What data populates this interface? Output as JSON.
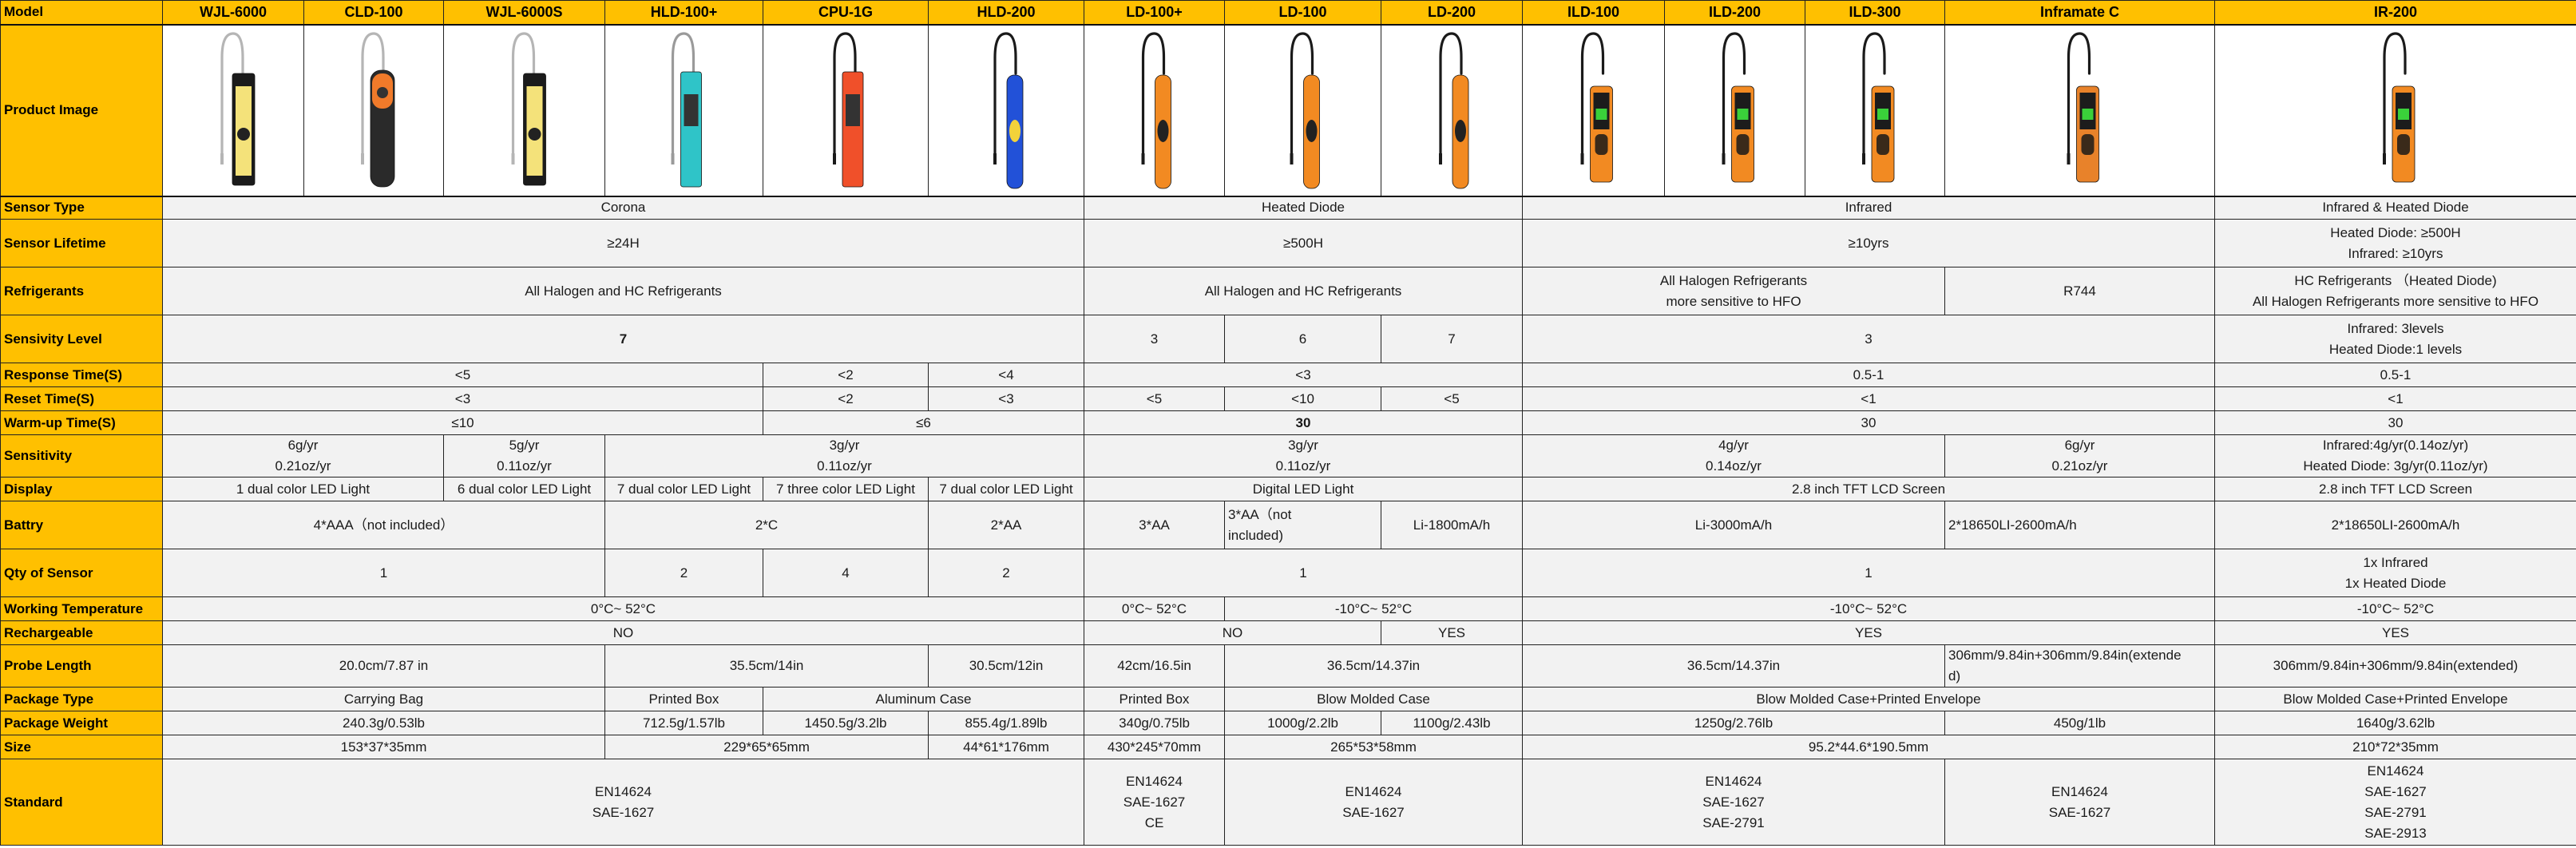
{
  "corner_label": "Model",
  "models": [
    "WJL-6000",
    "CLD-100",
    "WJL-6000S",
    "HLD-100+",
    "CPU-1G",
    "HLD-200",
    "LD-100+",
    "LD-100",
    "LD-200",
    "ILD-100",
    "ILD-200",
    "ILD-300",
    "Inframate C",
    "IR-200"
  ],
  "product_image_label": "Product Image",
  "product_images": [
    {
      "model": "WJL-6000",
      "body": "#1b1b1b",
      "panel": "#f4e27a",
      "probe": "#b5b5b5",
      "style": "bar"
    },
    {
      "model": "CLD-100",
      "body": "#2a2a2a",
      "panel": "#f07a2a",
      "probe": "#b5b5b5",
      "style": "round"
    },
    {
      "model": "WJL-6000S",
      "body": "#1b1b1b",
      "panel": "#f4e27a",
      "probe": "#b5b5b5",
      "style": "bar"
    },
    {
      "model": "HLD-100+",
      "body": "#2fc4c8",
      "panel": "#333333",
      "probe": "#9a9a9a",
      "style": "slab"
    },
    {
      "model": "CPU-1G",
      "body": "#f0502a",
      "panel": "#333333",
      "probe": "#1a1a1a",
      "style": "slab"
    },
    {
      "model": "HLD-200",
      "body": "#2251d8",
      "panel": "#f2d23a",
      "probe": "#1a1a1a",
      "style": "wand"
    },
    {
      "model": "LD-100+",
      "body": "#f28a22",
      "panel": "#222222",
      "probe": "#1a1a1a",
      "style": "wand"
    },
    {
      "model": "LD-100",
      "body": "#f28a22",
      "panel": "#222222",
      "probe": "#1a1a1a",
      "style": "wand"
    },
    {
      "model": "LD-200",
      "body": "#f28a22",
      "panel": "#222222",
      "probe": "#1a1a1a",
      "style": "wand"
    },
    {
      "model": "ILD-100",
      "body": "#f28a22",
      "panel": "#1c1c1c",
      "probe": "#1a1a1a",
      "style": "screen"
    },
    {
      "model": "ILD-200",
      "body": "#f28a22",
      "panel": "#1c1c1c",
      "probe": "#1a1a1a",
      "style": "screen"
    },
    {
      "model": "ILD-300",
      "body": "#f28a22",
      "panel": "#1c1c1c",
      "probe": "#1a1a1a",
      "style": "screen"
    },
    {
      "model": "Inframate C",
      "body": "#e8822a",
      "panel": "#1c1c1c",
      "probe": "#1a1a1a",
      "style": "screen"
    },
    {
      "model": "IR-200",
      "body": "#f28a22",
      "panel": "#1c1c1c",
      "probe": "#1a1a1a",
      "style": "screen"
    }
  ],
  "rows": [
    {
      "label": "Sensor Type",
      "cells": [
        {
          "span": 6,
          "lines": [
            "Corona"
          ]
        },
        {
          "span": 3,
          "lines": [
            "Heated Diode"
          ]
        },
        {
          "span": 4,
          "lines": [
            "Infrared"
          ]
        },
        {
          "span": 1,
          "lines": [
            "Infrared & Heated Diode"
          ]
        }
      ]
    },
    {
      "label": "Sensor Lifetime",
      "cells": [
        {
          "span": 6,
          "lines": [
            "≥24H"
          ]
        },
        {
          "span": 3,
          "lines": [
            "≥500H"
          ]
        },
        {
          "span": 4,
          "lines": [
            "≥10yrs"
          ]
        },
        {
          "span": 1,
          "lines": [
            "Heated Diode: ≥500H",
            "Infrared: ≥10yrs"
          ]
        }
      ]
    },
    {
      "label": "Refrigerants",
      "cells": [
        {
          "span": 6,
          "lines": [
            "All Halogen and HC Refrigerants"
          ]
        },
        {
          "span": 3,
          "lines": [
            "All Halogen and HC Refrigerants"
          ]
        },
        {
          "span": 3,
          "lines": [
            "All Halogen Refrigerants",
            "more sensitive to HFO"
          ]
        },
        {
          "span": 1,
          "lines": [
            "R744"
          ]
        },
        {
          "span": 1,
          "lines": [
            "HC Refrigerants （Heated Diode)",
            "All Halogen Refrigerants more sensitive to HFO"
          ]
        }
      ]
    },
    {
      "label": "Sensivity Level",
      "cells": [
        {
          "span": 6,
          "lines": [
            "7"
          ],
          "bold": true
        },
        {
          "span": 1,
          "lines": [
            "3"
          ]
        },
        {
          "span": 1,
          "lines": [
            "6"
          ]
        },
        {
          "span": 1,
          "lines": [
            "7"
          ]
        },
        {
          "span": 4,
          "lines": [
            "3"
          ]
        },
        {
          "span": 1,
          "lines": [
            "Infrared: 3levels",
            "Heated Diode:1 levels"
          ]
        }
      ]
    },
    {
      "label": "Response Time(S)",
      "cells": [
        {
          "span": 4,
          "lines": [
            "<5"
          ]
        },
        {
          "span": 1,
          "lines": [
            "<2"
          ]
        },
        {
          "span": 1,
          "lines": [
            "<4"
          ]
        },
        {
          "span": 3,
          "lines": [
            "<3"
          ]
        },
        {
          "span": 4,
          "lines": [
            "0.5-1"
          ]
        },
        {
          "span": 1,
          "lines": [
            "0.5-1"
          ]
        }
      ]
    },
    {
      "label": "Reset Time(S)",
      "cells": [
        {
          "span": 4,
          "lines": [
            "<3"
          ]
        },
        {
          "span": 1,
          "lines": [
            "<2"
          ]
        },
        {
          "span": 1,
          "lines": [
            "<3"
          ]
        },
        {
          "span": 1,
          "lines": [
            "<5"
          ]
        },
        {
          "span": 1,
          "lines": [
            "<10"
          ]
        },
        {
          "span": 1,
          "lines": [
            "<5"
          ]
        },
        {
          "span": 4,
          "lines": [
            "<1"
          ]
        },
        {
          "span": 1,
          "lines": [
            "<1"
          ]
        }
      ]
    },
    {
      "label": "Warm-up Time(S)",
      "cells": [
        {
          "span": 4,
          "lines": [
            "≤10"
          ]
        },
        {
          "span": 2,
          "lines": [
            "≤6"
          ]
        },
        {
          "span": 3,
          "lines": [
            "30"
          ],
          "bold": true
        },
        {
          "span": 4,
          "lines": [
            "30"
          ]
        },
        {
          "span": 1,
          "lines": [
            "30"
          ]
        }
      ]
    },
    {
      "label": "Sensitivity",
      "cells": [
        {
          "span": 2,
          "lines": [
            "6g/yr",
            "0.21oz/yr"
          ]
        },
        {
          "span": 1,
          "lines": [
            "5g/yr",
            "0.11oz/yr"
          ]
        },
        {
          "span": 3,
          "lines": [
            "3g/yr",
            "0.11oz/yr"
          ]
        },
        {
          "span": 3,
          "lines": [
            "3g/yr",
            "0.11oz/yr"
          ]
        },
        {
          "span": 3,
          "lines": [
            "4g/yr",
            "0.14oz/yr"
          ]
        },
        {
          "span": 1,
          "lines": [
            "6g/yr",
            "0.21oz/yr"
          ]
        },
        {
          "span": 1,
          "lines": [
            "Infrared:4g/yr(0.14oz/yr)",
            "Heated Diode: 3g/yr(0.11oz/yr)"
          ]
        }
      ]
    },
    {
      "label": "Display",
      "cells": [
        {
          "span": 2,
          "lines": [
            "1 dual color LED Light"
          ]
        },
        {
          "span": 1,
          "lines": [
            "6 dual color LED Light"
          ]
        },
        {
          "span": 1,
          "lines": [
            "7 dual color LED Light"
          ]
        },
        {
          "span": 1,
          "lines": [
            "7 three color LED Light"
          ]
        },
        {
          "span": 1,
          "lines": [
            "7 dual color LED Light"
          ]
        },
        {
          "span": 3,
          "lines": [
            "Digital LED Light"
          ]
        },
        {
          "span": 4,
          "lines": [
            "2.8 inch TFT LCD Screen"
          ]
        },
        {
          "span": 1,
          "lines": [
            "2.8 inch TFT LCD Screen"
          ]
        }
      ]
    },
    {
      "label": "Battry",
      "cells": [
        {
          "span": 3,
          "lines": [
            "4*AAA（not included）"
          ]
        },
        {
          "span": 2,
          "lines": [
            "2*C"
          ]
        },
        {
          "span": 1,
          "lines": [
            "2*AA"
          ]
        },
        {
          "span": 1,
          "lines": [
            "3*AA"
          ]
        },
        {
          "span": 1,
          "lines": [
            "3*AA（not",
            "included)"
          ],
          "left": true
        },
        {
          "span": 1,
          "lines": [
            "Li-1800mA/h"
          ]
        },
        {
          "span": 3,
          "lines": [
            "Li-3000mA/h"
          ]
        },
        {
          "span": 1,
          "lines": [
            "2*18650LI-2600mA/h"
          ],
          "left": true
        },
        {
          "span": 1,
          "lines": [
            "2*18650LI-2600mA/h"
          ]
        }
      ]
    },
    {
      "label": "Qty of Sensor",
      "cells": [
        {
          "span": 3,
          "lines": [
            "1"
          ]
        },
        {
          "span": 1,
          "lines": [
            "2"
          ]
        },
        {
          "span": 1,
          "lines": [
            "4"
          ]
        },
        {
          "span": 1,
          "lines": [
            "2"
          ]
        },
        {
          "span": 3,
          "lines": [
            "1"
          ]
        },
        {
          "span": 4,
          "lines": [
            "1"
          ]
        },
        {
          "span": 1,
          "lines": [
            "1x Infrared",
            "1x Heated Diode"
          ]
        }
      ]
    },
    {
      "label": "Working Temperature",
      "cells": [
        {
          "span": 6,
          "lines": [
            "0°C~ 52°C"
          ]
        },
        {
          "span": 1,
          "lines": [
            "0°C~ 52°C"
          ]
        },
        {
          "span": 2,
          "lines": [
            "-10°C~ 52°C"
          ]
        },
        {
          "span": 4,
          "lines": [
            "-10°C~ 52°C"
          ]
        },
        {
          "span": 1,
          "lines": [
            "-10°C~ 52°C"
          ]
        }
      ]
    },
    {
      "label": "Rechargeable",
      "cells": [
        {
          "span": 6,
          "lines": [
            "NO"
          ]
        },
        {
          "span": 2,
          "lines": [
            "NO"
          ]
        },
        {
          "span": 1,
          "lines": [
            "YES"
          ]
        },
        {
          "span": 4,
          "lines": [
            "YES"
          ]
        },
        {
          "span": 1,
          "lines": [
            "YES"
          ]
        }
      ]
    },
    {
      "label": "Probe Length",
      "cells": [
        {
          "span": 3,
          "lines": [
            "20.0cm/7.87 in"
          ]
        },
        {
          "span": 2,
          "lines": [
            "35.5cm/14in"
          ]
        },
        {
          "span": 1,
          "lines": [
            "30.5cm/12in"
          ]
        },
        {
          "span": 1,
          "lines": [
            "42cm/16.5in"
          ]
        },
        {
          "span": 2,
          "lines": [
            "36.5cm/14.37in"
          ]
        },
        {
          "span": 3,
          "lines": [
            "36.5cm/14.37in"
          ]
        },
        {
          "span": 1,
          "lines": [
            "306mm/9.84in+306mm/9.84in(extende",
            "d)"
          ],
          "left": true
        },
        {
          "span": 1,
          "lines": [
            "306mm/9.84in+306mm/9.84in(extended)"
          ]
        }
      ]
    },
    {
      "label": "Package Type",
      "cells": [
        {
          "span": 3,
          "lines": [
            "Carrying Bag"
          ]
        },
        {
          "span": 1,
          "lines": [
            "Printed Box"
          ]
        },
        {
          "span": 2,
          "lines": [
            "Aluminum Case"
          ]
        },
        {
          "span": 1,
          "lines": [
            "Printed Box"
          ]
        },
        {
          "span": 2,
          "lines": [
            "Blow Molded Case"
          ]
        },
        {
          "span": 4,
          "lines": [
            "Blow Molded Case+Printed Envelope"
          ]
        },
        {
          "span": 1,
          "lines": [
            "Blow Molded Case+Printed Envelope"
          ]
        }
      ]
    },
    {
      "label": "Package Weight",
      "cells": [
        {
          "span": 3,
          "lines": [
            "240.3g/0.53lb"
          ]
        },
        {
          "span": 1,
          "lines": [
            "712.5g/1.57lb"
          ]
        },
        {
          "span": 1,
          "lines": [
            "1450.5g/3.2lb"
          ]
        },
        {
          "span": 1,
          "lines": [
            "855.4g/1.89lb"
          ]
        },
        {
          "span": 1,
          "lines": [
            "340g/0.75lb"
          ]
        },
        {
          "span": 1,
          "lines": [
            "1000g/2.2lb"
          ]
        },
        {
          "span": 1,
          "lines": [
            "1100g/2.43lb"
          ]
        },
        {
          "span": 3,
          "lines": [
            "1250g/2.76lb"
          ]
        },
        {
          "span": 1,
          "lines": [
            "450g/1lb"
          ]
        },
        {
          "span": 1,
          "lines": [
            "1640g/3.62lb"
          ]
        }
      ]
    },
    {
      "label": "Size",
      "cells": [
        {
          "span": 3,
          "lines": [
            "153*37*35mm"
          ]
        },
        {
          "span": 2,
          "lines": [
            "229*65*65mm"
          ]
        },
        {
          "span": 1,
          "lines": [
            "44*61*176mm"
          ]
        },
        {
          "span": 1,
          "lines": [
            "430*245*70mm"
          ]
        },
        {
          "span": 2,
          "lines": [
            "265*53*58mm"
          ]
        },
        {
          "span": 4,
          "lines": [
            "95.2*44.6*190.5mm"
          ]
        },
        {
          "span": 1,
          "lines": [
            "210*72*35mm"
          ]
        }
      ]
    },
    {
      "label": "Standard",
      "cells": [
        {
          "span": 6,
          "lines": [
            "EN14624",
            "SAE-1627"
          ]
        },
        {
          "span": 1,
          "lines": [
            "EN14624",
            "SAE-1627",
            "CE"
          ]
        },
        {
          "span": 2,
          "lines": [
            "EN14624",
            "SAE-1627"
          ]
        },
        {
          "span": 3,
          "lines": [
            "EN14624",
            "SAE-1627",
            "SAE-2791"
          ]
        },
        {
          "span": 1,
          "lines": [
            "EN14624",
            "SAE-1627"
          ]
        },
        {
          "span": 1,
          "lines": [
            "EN14624",
            "SAE-1627",
            "SAE-2791",
            "SAE-2913"
          ]
        }
      ]
    }
  ]
}
